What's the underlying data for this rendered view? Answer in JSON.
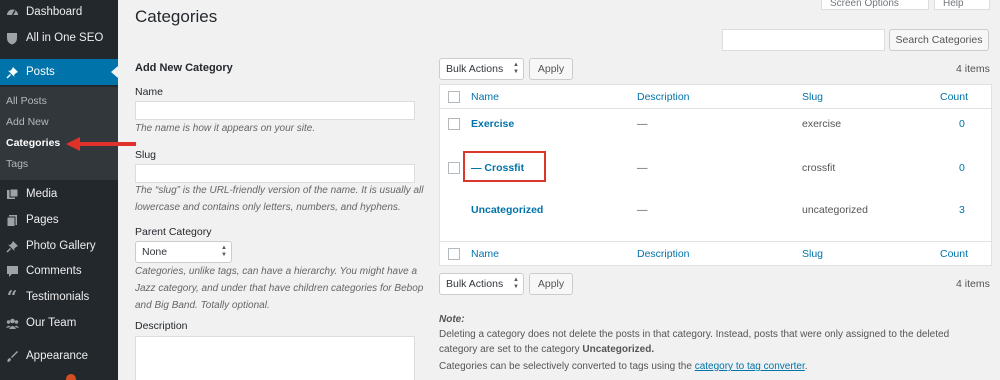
{
  "sidebar": {
    "items": [
      {
        "label": "Dashboard",
        "icon": "dashboard-icon"
      },
      {
        "label": "All in One SEO",
        "icon": "seo-shield-icon"
      },
      {
        "label": "Posts",
        "icon": "pin-icon"
      },
      {
        "label": "Media",
        "icon": "media-icon"
      },
      {
        "label": "Pages",
        "icon": "pages-icon"
      },
      {
        "label": "Photo Gallery",
        "icon": "gallery-pin-icon"
      },
      {
        "label": "Comments",
        "icon": "comment-icon"
      },
      {
        "label": "Testimonials",
        "icon": "quote-icon"
      },
      {
        "label": "Our Team",
        "icon": "team-icon"
      },
      {
        "label": "Appearance",
        "icon": "appearance-icon"
      }
    ],
    "submenu": [
      "All Posts",
      "Add New",
      "Categories",
      "Tags"
    ]
  },
  "header": {
    "title": "Categories",
    "screen_options": "Screen Options",
    "help": "Help",
    "search_button": "Search Categories"
  },
  "form": {
    "heading": "Add New Category",
    "name_label": "Name",
    "name_hint": "The name is how it appears on your site.",
    "slug_label": "Slug",
    "slug_hint": "The “slug” is the URL-friendly version of the name. It is usually all lowercase and contains only letters, numbers, and hyphens.",
    "parent_label": "Parent Category",
    "parent_value": "None",
    "parent_hint": "Categories, unlike tags, can have a hierarchy. You might have a Jazz category, and under that have children categories for Bebop and Big Band. Totally optional.",
    "description_label": "Description"
  },
  "list": {
    "bulk_actions": "Bulk Actions",
    "apply": "Apply",
    "items_count": "4 items",
    "columns": [
      "Name",
      "Description",
      "Slug",
      "Count"
    ],
    "rows": [
      {
        "name": "Exercise",
        "description": "—",
        "slug": "exercise",
        "count": "0"
      },
      {
        "name": "— Crossfit",
        "description": "—",
        "slug": "crossfit",
        "count": "0"
      },
      {
        "name": "Uncategorized",
        "description": "—",
        "slug": "uncategorized",
        "count": "3"
      }
    ]
  },
  "note": {
    "label": "Note:",
    "line1": "Deleting a category does not delete the posts in that category. Instead, posts that were only assigned to the deleted",
    "line2_prefix": "category are set to the category ",
    "line2_bold": "Uncategorized.",
    "line3_prefix": "Categories can be selectively converted to tags using the ",
    "line3_link": "category to tag converter",
    "line3_suffix": "."
  },
  "colors": {
    "sidebar_bg": "#23282d",
    "active": "#0073aa",
    "link": "#0073aa",
    "highlight": "#d9362c"
  }
}
